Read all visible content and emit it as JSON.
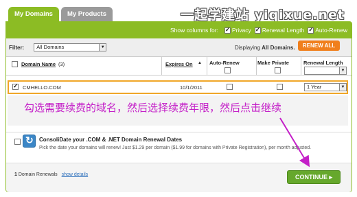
{
  "tabs": [
    {
      "label": "My Domains",
      "active": true
    },
    {
      "label": "My Products",
      "active": false
    }
  ],
  "watermark": "一起学建站 yiqixue.net",
  "columns_bar": {
    "label": "Show columns for:",
    "options": [
      {
        "label": "Privacy",
        "checked": true
      },
      {
        "label": "Renewal Length",
        "checked": true
      },
      {
        "label": "Auto-Renew",
        "checked": true
      }
    ]
  },
  "filter": {
    "label": "Filter:",
    "value": "All Domains",
    "displaying_prefix": "Displaying",
    "displaying_value": "All Domains.",
    "renew_all_label": "RENEW ALL"
  },
  "table": {
    "headers": {
      "domain": "Domain Name",
      "domain_count": "(3)",
      "expires": "Expires On",
      "expires_sort": "▲",
      "auto_renew": "Auto-Renew",
      "make_private": "Make Private",
      "renewal_length": "Renewal Length"
    },
    "rows": [
      {
        "domain": "CMHELLO.COM",
        "checked": true,
        "expires": "10/1/2011",
        "auto_renew": false,
        "make_private": false,
        "renewal_length": "1 Year"
      }
    ]
  },
  "annotation": "勾选需要续费的域名，然后选择续费年限，然后点击继续",
  "consolidate": {
    "title": "ConsoliDate your .COM & .NET Domain Renewal Dates",
    "description": "Pick the date your domains will renew! Just $1.29 per domain ($1.99 for domains with Private Registration), per month adjusted.",
    "checked": false
  },
  "footer": {
    "count": "1",
    "renewals_label": "Domain Renewals",
    "show_details": "show details",
    "continue_label": "CONTINUE",
    "continue_arrow": "▸"
  },
  "colors": {
    "accent_green": "#8cbc24",
    "renew_orange": "#f07f1c",
    "highlight_border": "#f0a628",
    "annotation_magenta": "#c41fc8",
    "continue_green": "#66a82c",
    "link_blue": "#2a6ebb"
  }
}
